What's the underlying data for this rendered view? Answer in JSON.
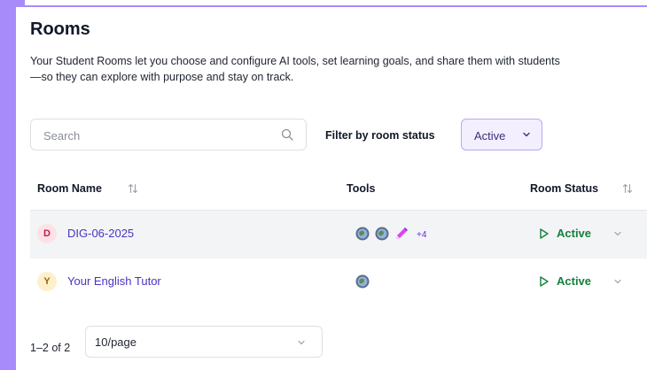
{
  "page": {
    "title": "Rooms",
    "description": "Your Student Rooms let you choose and configure AI tools, set learning goals, and share them with students—so they can explore with purpose and stay on track."
  },
  "search": {
    "placeholder": "Search",
    "value": ""
  },
  "filter": {
    "label": "Filter by room status",
    "selected": "Active"
  },
  "table": {
    "columns": {
      "room_name": "Room Name",
      "tools": "Tools",
      "room_status": "Room Status"
    },
    "rows": [
      {
        "avatar_letter": "D",
        "avatar_bg": "#fde2e4",
        "avatar_fg": "#c2185b",
        "name": "DIG-06-2025",
        "tools": [
          "globe-tool-icon",
          "globe-tool-icon",
          "pen-tool-icon"
        ],
        "more_tools": "+4",
        "status": "Active"
      },
      {
        "avatar_letter": "Y",
        "avatar_bg": "#fdf1cc",
        "avatar_fg": "#a16207",
        "name": "Your English Tutor",
        "tools": [
          "globe-tool-icon"
        ],
        "more_tools": "",
        "status": "Active"
      }
    ]
  },
  "pagination": {
    "range": "1–2 of 2",
    "page_size": "10/page"
  },
  "colors": {
    "accent": "#a78bfa",
    "link": "#4b32c3",
    "status_active": "#15803d",
    "row_highlight": "#f3f4f6"
  }
}
